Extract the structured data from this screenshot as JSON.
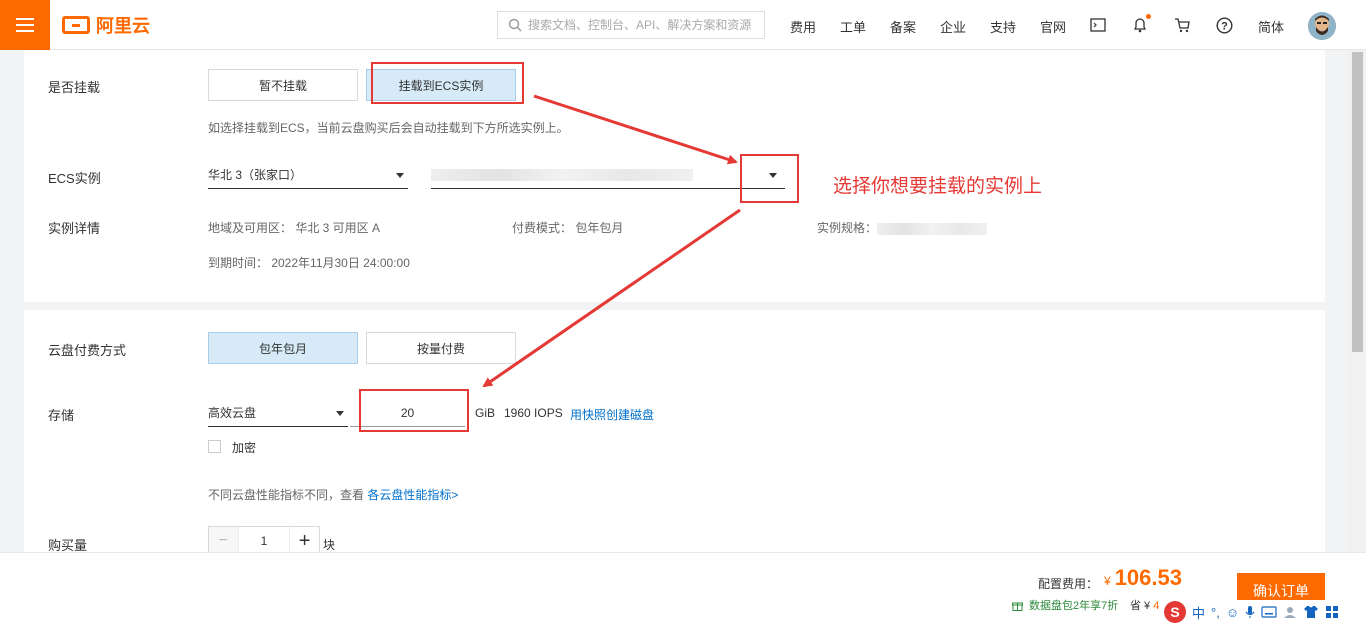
{
  "header": {
    "brand": "阿里云",
    "search_placeholder": "搜索文档、控制台、API、解决方案和资源",
    "nav": [
      "费用",
      "工单",
      "备案",
      "企业",
      "支持",
      "官网"
    ],
    "lang": "简体"
  },
  "mount": {
    "label": "是否挂载",
    "options": [
      "暂不挂载",
      "挂载到ECS实例"
    ],
    "selected": "挂载到ECS实例",
    "hint": "如选择挂载到ECS，当前云盘购买后会自动挂载到下方所选实例上。"
  },
  "ecs": {
    "label": "ECS实例",
    "region": "华北 3（张家口）"
  },
  "detail": {
    "label": "实例详情",
    "zone": "地域及可用区： 华北 3 可用区 A",
    "billing": "付费模式： 包年包月",
    "spec": "实例规格：",
    "expire": "到期时间： 2022年11月30日 24:00:00"
  },
  "annotation": "选择你想要挂载的实例上",
  "billing_method": {
    "label": "云盘付费方式",
    "options": [
      "包年包月",
      "按量付费"
    ],
    "selected": "包年包月"
  },
  "storage": {
    "label": "存储",
    "type": "高效云盘",
    "size": "20",
    "unit": "GiB",
    "iops": "1960 IOPS",
    "snapshot_link": "用快照创建磁盘",
    "encrypt": "加密",
    "perf_hint": "不同云盘性能指标不同，查看",
    "perf_link": "各云盘性能指标>"
  },
  "quantity": {
    "label": "购买量",
    "minus": "−",
    "value": "1",
    "plus": "+",
    "unit": "块"
  },
  "footer": {
    "price_label": "配置费用：",
    "currency": "¥",
    "price": "106.53",
    "promo": "数据盘包2年享7折",
    "save_label": "省 ¥",
    "save_value": "45.66",
    "confirm": "确认订单"
  },
  "ime": {
    "logo": "S",
    "mode": "中"
  }
}
